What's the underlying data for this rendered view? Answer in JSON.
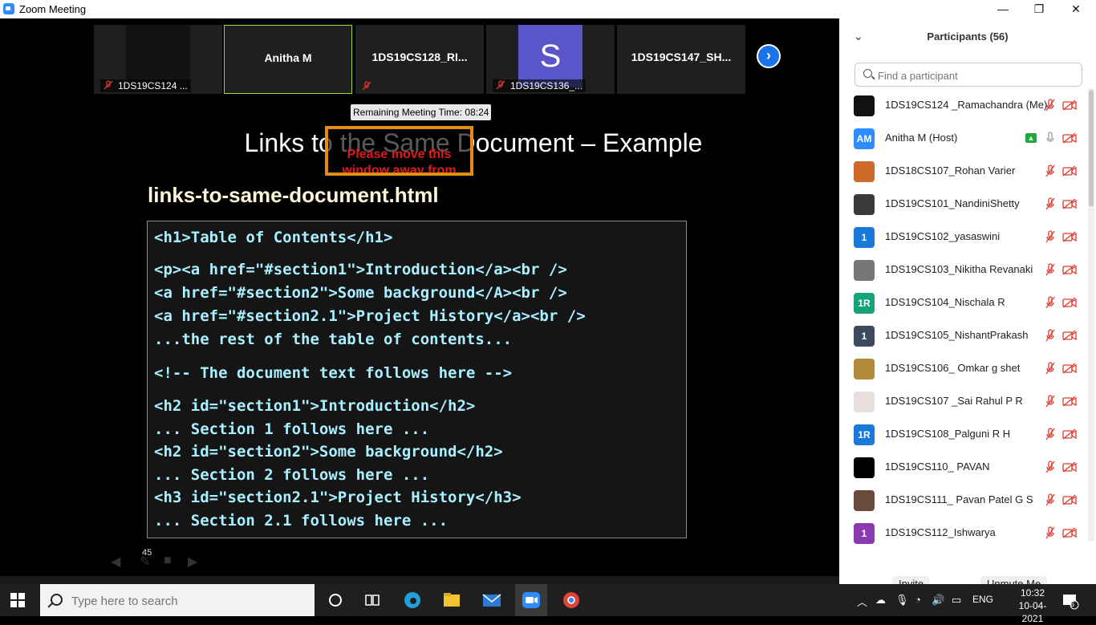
{
  "window": {
    "title": "Zoom Meeting",
    "minimize": "—",
    "restore": "❐",
    "close": "✕"
  },
  "strip": {
    "tiles": [
      {
        "name": "",
        "label": "1DS19CS124 ..."
      },
      {
        "name": "Anitha M",
        "label": ""
      },
      {
        "name": "1DS19CS128_RI...",
        "label": ""
      },
      {
        "name": "S",
        "label": "1DS19CS136_..."
      },
      {
        "name": "1DS19CS147_SH...",
        "label": ""
      }
    ],
    "next": "›"
  },
  "timer": "Remaining Meeting Time: 08:24",
  "slide": {
    "title": "Links to the Same Document – Example",
    "popup": "Please move this window away from",
    "file_title": "links-to-same-document.html",
    "code": {
      "b1": "<h1>Table of Contents</h1>",
      "b2": "<p><a href=\"#section1\">Introduction</a><br />\n<a href=\"#section2\">Some background</A><br />\n<a href=\"#section2.1\">Project History</a><br />\n...the rest of the table of contents...",
      "b3": "<!-- The document text follows here -->",
      "b4": "<h2 id=\"section1\">Introduction</h2>\n... Section 1 follows here ...\n<h2 id=\"section2\">Some background</h2>\n... Section 2 follows here ...\n<h3 id=\"section2.1\">Project History</h3>\n... Section 2.1 follows here ..."
    },
    "slide_number": "45"
  },
  "participants": {
    "title": "Participants (56)",
    "search_placeholder": "Find a participant",
    "items": [
      {
        "name": "1DS19CS124 _Ramachandra (Me)",
        "avatar": "",
        "color": "#111111"
      },
      {
        "name": "Anitha M (Host)",
        "avatar": "AM",
        "color": "#2d8cff"
      },
      {
        "name": "1DS18CS107_Rohan Varier",
        "avatar": "",
        "color": "#d06a2a"
      },
      {
        "name": "1DS19CS101_NandiniShetty",
        "avatar": "",
        "color": "#3a3a3a"
      },
      {
        "name": "1DS19CS102_yasaswini",
        "avatar": "1",
        "color": "#1a7ad9"
      },
      {
        "name": "1DS19CS103_Nikitha Revanaki",
        "avatar": "",
        "color": "#777777"
      },
      {
        "name": "1DS19CS104_Nischala R",
        "avatar": "1R",
        "color": "#17a37a"
      },
      {
        "name": "1DS19CS105_NishantPrakash",
        "avatar": "1",
        "color": "#3b4a5c"
      },
      {
        "name": "1DS19CS106_ Omkar g shet",
        "avatar": "",
        "color": "#b08a3a"
      },
      {
        "name": "1DS19CS107 _Sai Rahul P R",
        "avatar": "",
        "color": "#e8dede"
      },
      {
        "name": "1DS19CS108_Palguni R H",
        "avatar": "1R",
        "color": "#1a7ad9"
      },
      {
        "name": "1DS19CS110_ PAVAN",
        "avatar": "",
        "color": "#000000"
      },
      {
        "name": "1DS19CS111_ Pavan Patel G S",
        "avatar": "",
        "color": "#6a4a3a"
      },
      {
        "name": "1DS19CS112_Ishwarya",
        "avatar": "1",
        "color": "#8a3ab0"
      }
    ],
    "invite": "Invite",
    "unmute": "Unmute Me"
  },
  "taskbar": {
    "search_placeholder": "Type here to search",
    "lang": "ENG",
    "time": "10:32",
    "date": "10-04-2021",
    "notifications": "6"
  },
  "colors": {
    "accent": "#2d8cff",
    "muted_red": "#e0382c",
    "code_text": "#a8f0ff"
  }
}
